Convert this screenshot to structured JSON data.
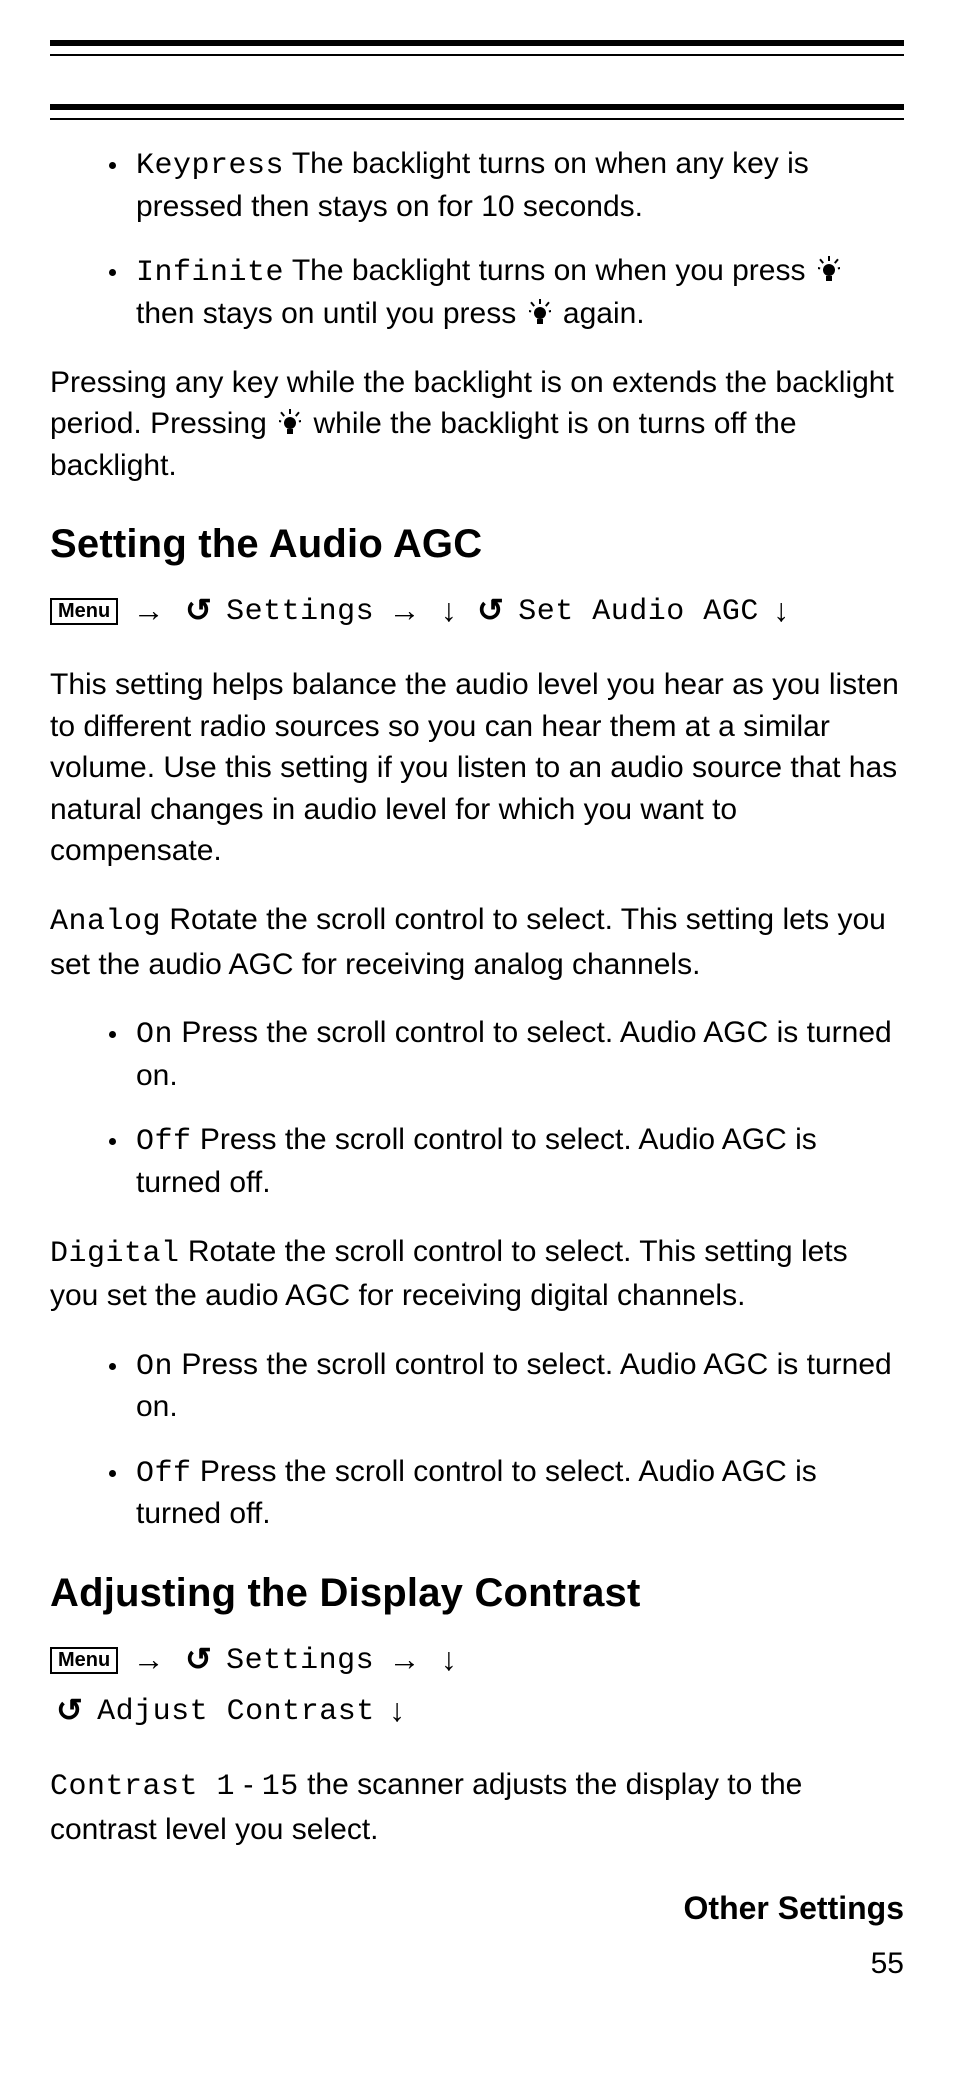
{
  "menu_label": "Menu",
  "nav_settings": "Settings",
  "nav_set_audio_agc": "Set Audio AGC",
  "nav_adjust_contrast": "Adjust Contrast",
  "bullet_keypress_pre": "Keypress",
  "bullet_keypress_body": "The backlight turns on when any key is pressed then stays on for 10 seconds.",
  "bullet_infinite_pre": "Infinite",
  "bullet_infinite_b1": "The backlight turns on when you press",
  "bullet_infinite_b2": "then stays on until you press",
  "bullet_infinite_b3": "again.",
  "para_backlight_a": "Pressing any key while the backlight is on extends the backlight period. Pressing",
  "para_backlight_b": "while the backlight is on turns off the backlight.",
  "heading_agc": "Setting the Audio AGC",
  "para_agc_intro": "This setting helps balance the audio level you hear as you listen to different radio sources so you can hear them at a similar volume. Use this setting if you listen to an audio source that has natural changes in audio level for which you want to compensate.",
  "analog_label": "Analog",
  "analog_body": "Rotate the scroll control to select. This setting lets you set the audio AGC for receiving analog channels.",
  "on_label": "On",
  "on_body": "Press the scroll control to select. Audio AGC is turned on.",
  "off_label": "Off",
  "off_body": "Press the scroll control to select. Audio AGC is turned off.",
  "digital_label": "Digital",
  "digital_body": "Rotate the scroll control to select. This setting lets you set the audio AGC for receiving digital channels.",
  "heading_contrast": "Adjusting the Display Contrast",
  "contrast_range_a": "Contrast 1",
  "contrast_dash": " - ",
  "contrast_range_b": "15",
  "contrast_body": "the scanner adjusts the display to the contrast level you select.",
  "footer_heading": "Other Settings",
  "page_number": "55"
}
